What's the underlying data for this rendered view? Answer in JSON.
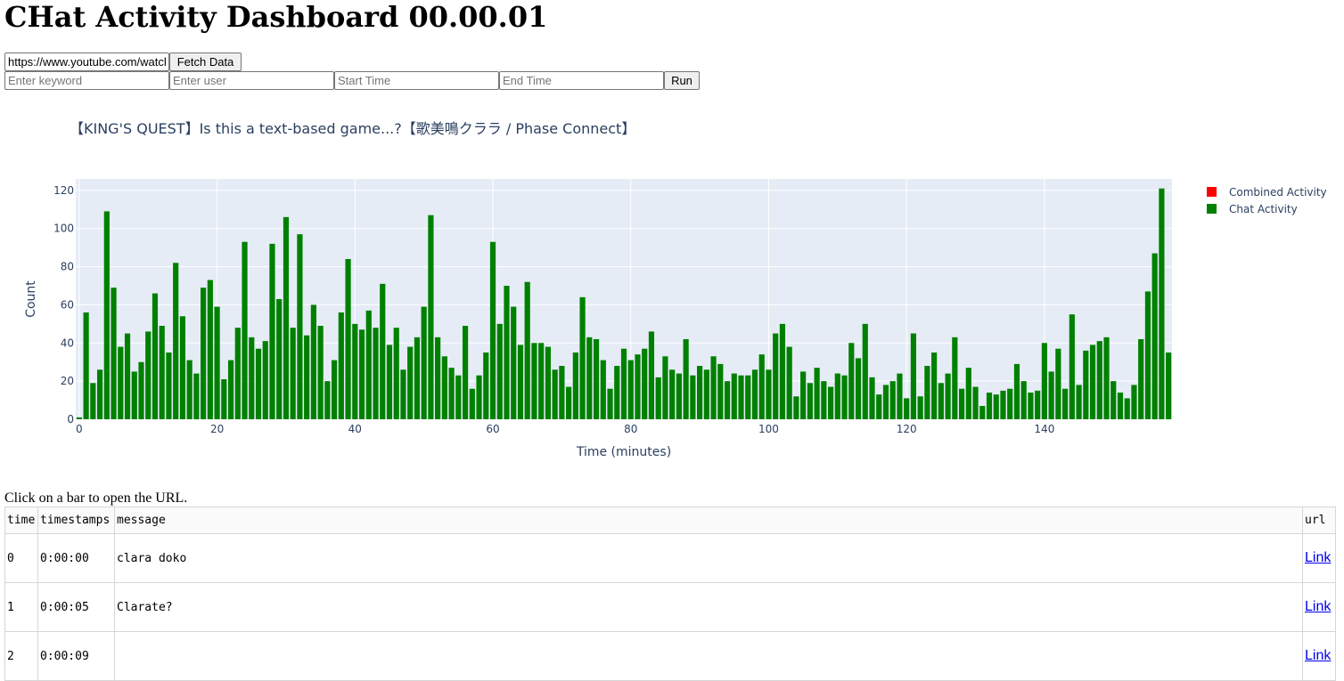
{
  "app": {
    "title": "CHat Activity Dashboard 00.00.01"
  },
  "controls": {
    "url_value": "https://www.youtube.com/watch?v=",
    "fetch_label": "Fetch Data",
    "keyword_placeholder": "Enter keyword",
    "user_placeholder": "Enter user",
    "start_placeholder": "Start Time",
    "end_placeholder": "End Time",
    "run_label": "Run"
  },
  "chart_data": {
    "type": "bar",
    "title": "【KING'S QUEST】Is this a text-based game...?【歌美鳴クララ / Phase Connect】",
    "xlabel": "Time (minutes)",
    "ylabel": "Count",
    "xlim": [
      -0.5,
      158.5
    ],
    "ylim": [
      0,
      126
    ],
    "xticks": [
      0,
      20,
      40,
      60,
      80,
      100,
      120,
      140
    ],
    "yticks": [
      0,
      20,
      40,
      60,
      80,
      100,
      120
    ],
    "grid": true,
    "legend_position": "top-right",
    "background": "#e5ecf6",
    "series": [
      {
        "name": "Combined Activity",
        "color": "#ff0000",
        "values": []
      },
      {
        "name": "Chat Activity",
        "color": "#008000",
        "x_start": 0,
        "values": [
          1,
          56,
          19,
          26,
          109,
          69,
          38,
          45,
          25,
          30,
          46,
          66,
          49,
          35,
          82,
          54,
          31,
          24,
          69,
          73,
          59,
          21,
          31,
          48,
          93,
          43,
          37,
          41,
          92,
          63,
          106,
          48,
          97,
          44,
          60,
          49,
          20,
          31,
          56,
          84,
          50,
          47,
          57,
          48,
          71,
          39,
          48,
          26,
          38,
          43,
          59,
          107,
          43,
          33,
          27,
          23,
          49,
          16,
          23,
          35,
          93,
          50,
          70,
          59,
          39,
          72,
          40,
          40,
          38,
          26,
          28,
          17,
          35,
          64,
          43,
          42,
          31,
          16,
          28,
          37,
          31,
          34,
          37,
          46,
          22,
          33,
          26,
          24,
          42,
          23,
          28,
          26,
          33,
          29,
          20,
          24,
          23,
          23,
          26,
          34,
          26,
          45,
          50,
          38,
          12,
          25,
          19,
          27,
          20,
          17,
          24,
          23,
          40,
          32,
          50,
          22,
          13,
          18,
          20,
          24,
          11,
          45,
          12,
          28,
          35,
          19,
          24,
          43,
          16,
          27,
          17,
          7,
          14,
          13,
          15,
          16,
          29,
          20,
          14,
          15,
          40,
          25,
          37,
          16,
          55,
          18,
          36,
          39,
          41,
          43,
          20,
          14,
          11,
          18,
          42,
          67,
          87,
          121,
          35
        ]
      }
    ]
  },
  "table": {
    "hint": "Click on a bar to open the URL.",
    "headers": [
      "time",
      "timestamps",
      "message",
      "url"
    ],
    "rows": [
      {
        "time": "0",
        "timestamps": "0:00:00",
        "message": "clara doko",
        "url_label": "Link"
      },
      {
        "time": "1",
        "timestamps": "0:00:05",
        "message": "Clarate?",
        "url_label": "Link"
      },
      {
        "time": "2",
        "timestamps": "0:00:09",
        "message": "",
        "url_label": "Link"
      }
    ]
  }
}
